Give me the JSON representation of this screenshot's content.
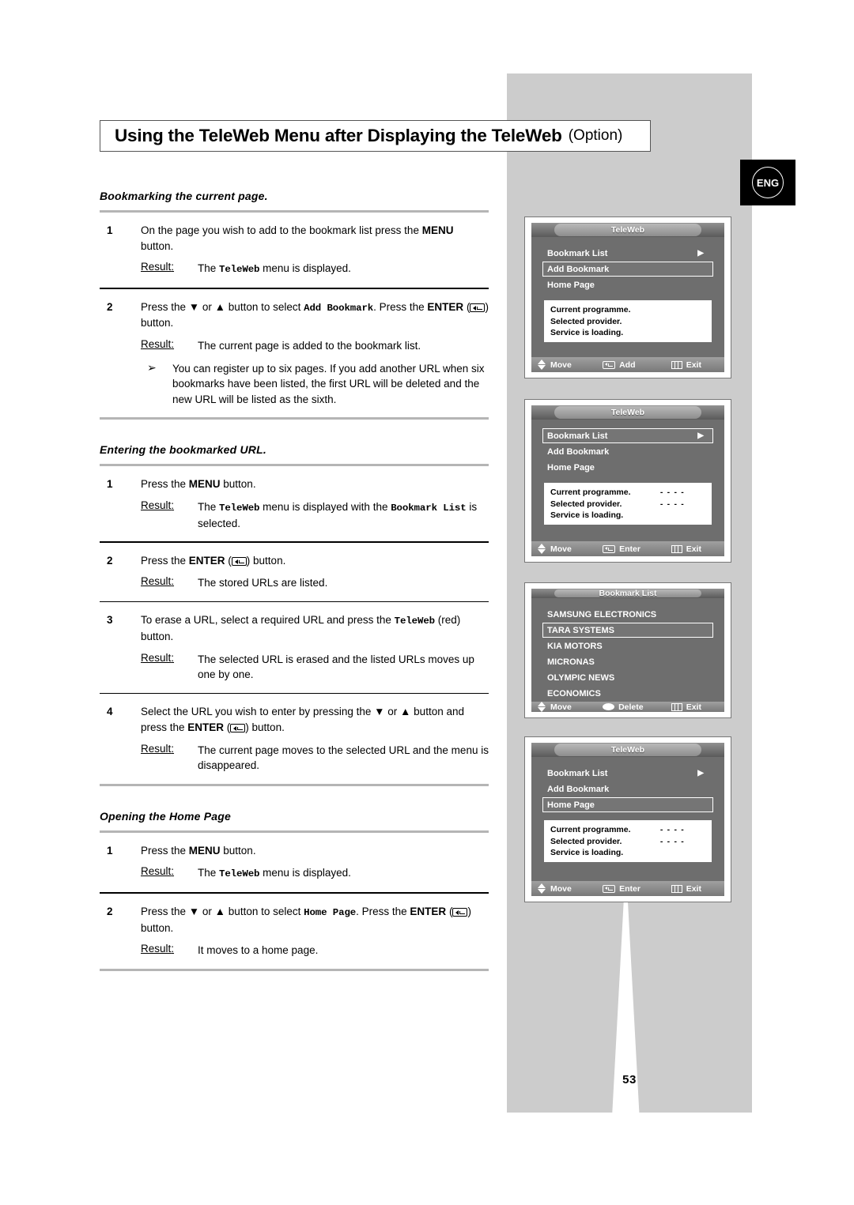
{
  "page": {
    "number": "53",
    "language_badge": "ENG"
  },
  "title": {
    "main": "Using the TeleWeb Menu after Displaying the TeleWeb",
    "option": "(Option)"
  },
  "sections": [
    {
      "heading": "Bookmarking the current page.",
      "steps": [
        {
          "num": "1",
          "lines": [
            {
              "parts": [
                {
                  "t": "On the page you wish to add to the bookmark list press the ",
                  "s": "n"
                },
                {
                  "t": "MENU",
                  "s": "b"
                },
                {
                  "t": " button.",
                  "s": "n"
                }
              ]
            }
          ],
          "result": {
            "label": "Result",
            "colon": ":",
            "parts": [
              {
                "t": "The ",
                "s": "n"
              },
              {
                "t": "TeleWeb",
                "s": "m"
              },
              {
                "t": " menu is displayed.",
                "s": "n"
              }
            ]
          }
        },
        {
          "num": "2",
          "lines": [
            {
              "parts": [
                {
                  "t": "Press the ",
                  "s": "n"
                },
                {
                  "t": "▼",
                  "s": "n"
                },
                {
                  "t": " or ",
                  "s": "n"
                },
                {
                  "t": "▲",
                  "s": "n"
                },
                {
                  "t": " button to select ",
                  "s": "n"
                },
                {
                  "t": "Add Bookmark",
                  "s": "m"
                },
                {
                  "t": ". Press the ",
                  "s": "n"
                },
                {
                  "t": "ENTER",
                  "s": "b"
                },
                {
                  "t": " (",
                  "s": "n"
                },
                {
                  "t": "ENTERKEY",
                  "s": "k"
                },
                {
                  "t": ") button.",
                  "s": "n"
                }
              ]
            }
          ],
          "result": {
            "label": "Result",
            "colon": ":",
            "parts": [
              {
                "t": "The current page is added to the bookmark list.",
                "s": "n"
              }
            ]
          },
          "note": {
            "bullet": "➢",
            "parts": [
              {
                "t": "You can register up to six pages. If you add another URL when six bookmarks have been listed, the first URL will be deleted and the new URL will be listed as the sixth.",
                "s": "n"
              }
            ]
          }
        }
      ]
    },
    {
      "heading": "Entering the bookmarked URL.",
      "steps": [
        {
          "num": "1",
          "lines": [
            {
              "parts": [
                {
                  "t": "Press the ",
                  "s": "n"
                },
                {
                  "t": "MENU",
                  "s": "b"
                },
                {
                  "t": " button.",
                  "s": "n"
                }
              ]
            }
          ],
          "result": {
            "label": "Result",
            "colon": ":",
            "parts": [
              {
                "t": "The ",
                "s": "n"
              },
              {
                "t": "TeleWeb",
                "s": "m"
              },
              {
                "t": " menu is displayed with the ",
                "s": "n"
              },
              {
                "t": "Bookmark List",
                "s": "m"
              },
              {
                "t": " is selected.",
                "s": "n"
              }
            ]
          }
        },
        {
          "num": "2",
          "lines": [
            {
              "parts": [
                {
                  "t": "Press the ",
                  "s": "n"
                },
                {
                  "t": "ENTER",
                  "s": "b"
                },
                {
                  "t": " (",
                  "s": "n"
                },
                {
                  "t": "ENTERKEY",
                  "s": "k"
                },
                {
                  "t": ") button.",
                  "s": "n"
                }
              ]
            }
          ],
          "result": {
            "label": "Result",
            "colon": ":",
            "parts": [
              {
                "t": "The stored URLs are listed.",
                "s": "n"
              }
            ]
          }
        },
        {
          "num": "3",
          "lines": [
            {
              "parts": [
                {
                  "t": "To erase a URL, select a required URL and press the ",
                  "s": "n"
                },
                {
                  "t": "TeleWeb",
                  "s": "m"
                },
                {
                  "t": " (red) button.",
                  "s": "n"
                }
              ]
            }
          ],
          "result": {
            "label": "Result",
            "colon": ":",
            "parts": [
              {
                "t": "The  selected URL is erased and the listed URLs moves up one by one.",
                "s": "n"
              }
            ]
          }
        },
        {
          "num": "4",
          "lines": [
            {
              "parts": [
                {
                  "t": "Select the URL you wish to enter by pressing the ",
                  "s": "n"
                },
                {
                  "t": "▼",
                  "s": "n"
                },
                {
                  "t": " or ",
                  "s": "n"
                },
                {
                  "t": "▲",
                  "s": "n"
                },
                {
                  "t": " button and press the ",
                  "s": "n"
                },
                {
                  "t": "ENTER",
                  "s": "b"
                },
                {
                  "t": " (",
                  "s": "n"
                },
                {
                  "t": "ENTERKEY",
                  "s": "k"
                },
                {
                  "t": ") button.",
                  "s": "n"
                }
              ]
            }
          ],
          "result": {
            "label": "Result",
            "colon": ":",
            "parts": [
              {
                "t": "The current page moves to the selected URL and the menu is disappeared.",
                "s": "n"
              }
            ]
          }
        }
      ]
    },
    {
      "heading": "Opening the Home Page",
      "steps": [
        {
          "num": "1",
          "lines": [
            {
              "parts": [
                {
                  "t": "Press the ",
                  "s": "n"
                },
                {
                  "t": "MENU",
                  "s": "b"
                },
                {
                  "t": " button.",
                  "s": "n"
                }
              ]
            }
          ],
          "result": {
            "label": "Result",
            "colon": ":",
            "parts": [
              {
                "t": "The ",
                "s": "n"
              },
              {
                "t": "TeleWeb",
                "s": "m"
              },
              {
                "t": " menu is displayed.",
                "s": "n"
              }
            ]
          }
        },
        {
          "num": "2",
          "lines": [
            {
              "parts": [
                {
                  "t": "Press the ",
                  "s": "n"
                },
                {
                  "t": "▼",
                  "s": "n"
                },
                {
                  "t": " or ",
                  "s": "n"
                },
                {
                  "t": "▲",
                  "s": "n"
                },
                {
                  "t": " button to select ",
                  "s": "n"
                },
                {
                  "t": "Home Page",
                  "s": "m"
                },
                {
                  "t": ". Press the ",
                  "s": "n"
                },
                {
                  "t": "ENTER",
                  "s": "b"
                },
                {
                  "t": " (",
                  "s": "n"
                },
                {
                  "t": "ENTERKEY",
                  "s": "k"
                },
                {
                  "t": ") button.",
                  "s": "n"
                }
              ]
            }
          ],
          "result": {
            "label": "Result",
            "colon": ":",
            "parts": [
              {
                "t": "It moves to a home page.",
                "s": "n"
              }
            ]
          }
        }
      ]
    }
  ],
  "osd_panels": [
    {
      "title": "TeleWeb",
      "items": [
        {
          "label": "Bookmark List",
          "arrow": "▶",
          "selected": false
        },
        {
          "label": "Add Bookmark",
          "arrow": "",
          "selected": true
        },
        {
          "label": "Home Page",
          "arrow": "",
          "selected": false
        }
      ],
      "info": [
        {
          "label": "Current programme.",
          "value": ""
        },
        {
          "label": "Selected provider.",
          "value": ""
        },
        {
          "label": "Service is loading.",
          "value": ""
        }
      ],
      "footer": [
        {
          "icon": "updown-icon",
          "label": "Move"
        },
        {
          "icon": "enter-key-icon",
          "label": "Add"
        },
        {
          "icon": "exit-menu-icon",
          "label": "Exit"
        }
      ]
    },
    {
      "title": "TeleWeb",
      "items": [
        {
          "label": "Bookmark List",
          "arrow": "▶",
          "selected": true
        },
        {
          "label": "Add Bookmark",
          "arrow": "",
          "selected": false
        },
        {
          "label": "Home Page",
          "arrow": "",
          "selected": false
        }
      ],
      "info": [
        {
          "label": "Current programme.",
          "value": "- - - -"
        },
        {
          "label": "Selected provider.",
          "value": "- - - -"
        },
        {
          "label": "Service is loading.",
          "value": ""
        }
      ],
      "footer": [
        {
          "icon": "updown-icon",
          "label": "Move"
        },
        {
          "icon": "enter-key-icon",
          "label": "Enter"
        },
        {
          "icon": "exit-menu-icon",
          "label": "Exit"
        }
      ]
    },
    {
      "title": "Bookmark List",
      "items": [
        {
          "label": "SAMSUNG ELECTRONICS",
          "arrow": "",
          "selected": false
        },
        {
          "label": "TARA SYSTEMS",
          "arrow": "",
          "selected": true
        },
        {
          "label": "KIA MOTORS",
          "arrow": "",
          "selected": false
        },
        {
          "label": "MICRONAS",
          "arrow": "",
          "selected": false
        },
        {
          "label": "OLYMPIC NEWS",
          "arrow": "",
          "selected": false
        },
        {
          "label": "ECONOMICS",
          "arrow": "",
          "selected": false
        }
      ],
      "info": [],
      "footer": [
        {
          "icon": "updown-icon",
          "label": "Move"
        },
        {
          "icon": "red-button-icon",
          "label": "Delete"
        },
        {
          "icon": "exit-menu-icon",
          "label": "Exit"
        }
      ]
    },
    {
      "title": "TeleWeb",
      "items": [
        {
          "label": "Bookmark List",
          "arrow": "▶",
          "selected": false
        },
        {
          "label": "Add Bookmark",
          "arrow": "",
          "selected": false
        },
        {
          "label": "Home Page",
          "arrow": "",
          "selected": true
        }
      ],
      "info": [
        {
          "label": "Current programme.",
          "value": "- - - -"
        },
        {
          "label": "Selected provider.",
          "value": "- - - -"
        },
        {
          "label": "Service is loading.",
          "value": ""
        }
      ],
      "footer": [
        {
          "icon": "updown-icon",
          "label": "Move"
        },
        {
          "icon": "enter-key-icon",
          "label": "Enter"
        },
        {
          "icon": "exit-menu-icon",
          "label": "Exit"
        }
      ]
    }
  ],
  "colors": {
    "panel_grey": "#cccccc",
    "osd_grey": "#6e6e6e",
    "rule_grey": "#b5b5b5"
  }
}
